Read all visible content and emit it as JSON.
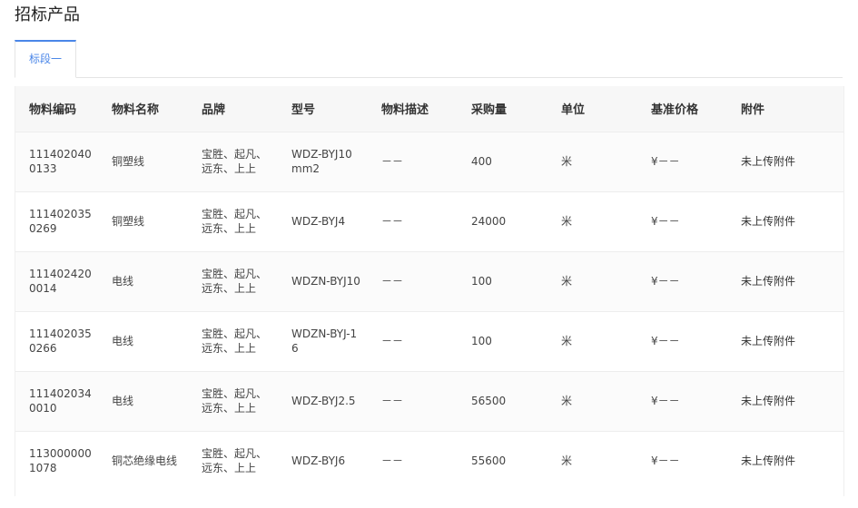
{
  "page": {
    "title": "招标产品"
  },
  "tabs": [
    {
      "label": "标段一"
    }
  ],
  "table": {
    "headers": [
      "物料编码",
      "物料名称",
      "品牌",
      "型号",
      "物料描述",
      "采购量",
      "单位",
      "基准价格",
      "附件"
    ],
    "rows": [
      [
        "1114020400133",
        "铜塑线",
        "宝胜、起凡、远东、上上",
        "WDZ-BYJ10mm2",
        "－－",
        "400",
        "米",
        "¥－－",
        "未上传附件"
      ],
      [
        "1114020350269",
        "铜塑线",
        "宝胜、起凡、远东、上上",
        "WDZ-BYJ4",
        "－－",
        "24000",
        "米",
        "¥－－",
        "未上传附件"
      ],
      [
        "1114024200014",
        "电线",
        "宝胜、起凡、远东、上上",
        "WDZN-BYJ10",
        "－－",
        "100",
        "米",
        "¥－－",
        "未上传附件"
      ],
      [
        "1114020350266",
        "电线",
        "宝胜、起凡、远东、上上",
        "WDZN-BYJ-16",
        "－－",
        "100",
        "米",
        "¥－－",
        "未上传附件"
      ],
      [
        "1114020340010",
        "电线",
        "宝胜、起凡、远东、上上",
        "WDZ-BYJ2.5",
        "－－",
        "56500",
        "米",
        "¥－－",
        "未上传附件"
      ],
      [
        "1130000001078",
        "铜芯绝缘电线",
        "宝胜、起凡、远东、上上",
        "WDZ-BYJ6",
        "－－",
        "55600",
        "米",
        "¥－－",
        "未上传附件"
      ]
    ]
  },
  "colors": {
    "accent": "#4a86e8",
    "header_bg": "#f7f7f7",
    "border": "#e4e4e4"
  }
}
